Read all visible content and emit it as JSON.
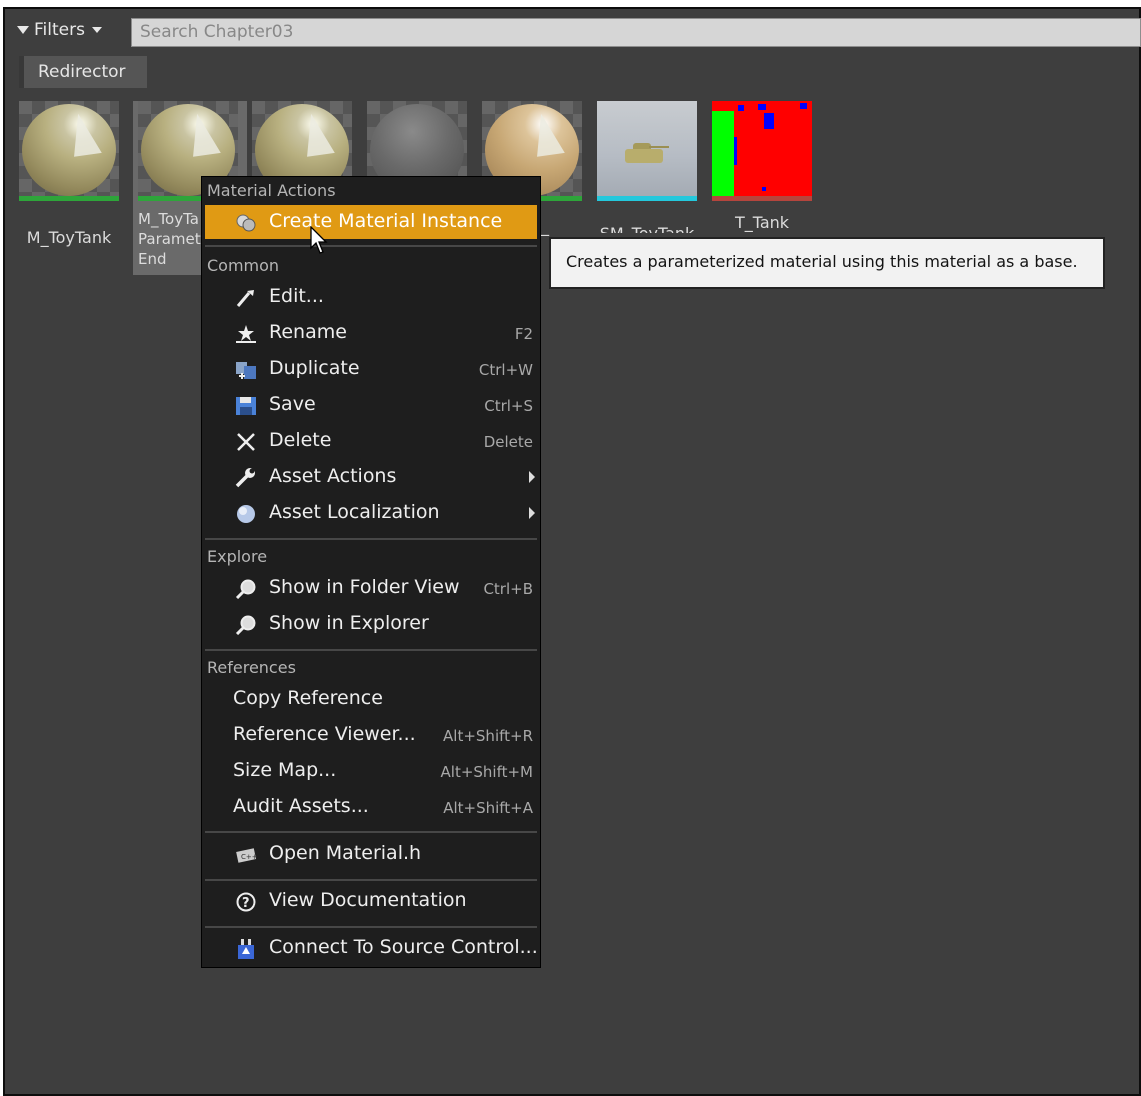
{
  "toolbar": {
    "filters_label": "Filters",
    "search_placeholder": "Search Chapter03"
  },
  "redirector_label": "Redirector",
  "assets": [
    {
      "label": "M_ToyTank",
      "bar_color": "#2ea53a"
    },
    {
      "label": "M_ToyTa Paramete End",
      "bar_color": "#2ea53a"
    },
    {
      "label": "",
      "bar_color": "#2ea53a"
    },
    {
      "label": "",
      "bar_color": "#2ea53a"
    },
    {
      "label": "Tank_",
      "bar_color": "#2ea53a"
    },
    {
      "label": "SM_ToyTank",
      "bar_color": "#24c8dc"
    },
    {
      "label": "T_Tank",
      "bar_color": "#b5453d"
    }
  ],
  "menu": {
    "material_actions": "Material Actions",
    "create_instance": "Create Material Instance",
    "common": "Common",
    "edit": "Edit...",
    "rename": "Rename",
    "rename_shortcut": "F2",
    "duplicate": "Duplicate",
    "duplicate_shortcut": "Ctrl+W",
    "save": "Save",
    "save_shortcut": "Ctrl+S",
    "delete": "Delete",
    "delete_shortcut": "Delete",
    "asset_actions": "Asset Actions",
    "asset_localization": "Asset Localization",
    "explore": "Explore",
    "show_folder": "Show in Folder View",
    "show_folder_shortcut": "Ctrl+B",
    "show_explorer": "Show in Explorer",
    "references": "References",
    "copy_reference": "Copy Reference",
    "reference_viewer": "Reference Viewer...",
    "reference_viewer_shortcut": "Alt+Shift+R",
    "size_map": "Size Map...",
    "size_map_shortcut": "Alt+Shift+M",
    "audit_assets": "Audit Assets...",
    "audit_assets_shortcut": "Alt+Shift+A",
    "open_material_h": "Open Material.h",
    "view_docs": "View Documentation",
    "connect_source": "Connect To Source Control..."
  },
  "tooltip": "Creates a parameterized material using this material as a base.",
  "colors": {
    "highlight": "#e09a14",
    "background": "#3e3e3e",
    "menu_bg": "#1e1e1e"
  },
  "icons": [
    "funnel-icon",
    "material-instance-icon",
    "edit-icon",
    "rename-icon",
    "duplicate-icon",
    "save-icon",
    "delete-icon",
    "wrench-icon",
    "globe-icon",
    "magnifier-icon",
    "code-file-icon",
    "help-icon",
    "source-control-icon"
  ]
}
